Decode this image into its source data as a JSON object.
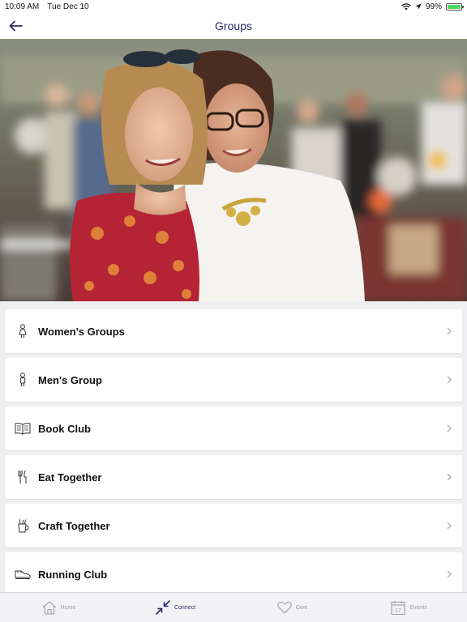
{
  "status_bar": {
    "time": "10:09 AM",
    "date": "Tue Dec 10",
    "battery": "99%"
  },
  "nav": {
    "title": "Groups"
  },
  "hero": {
    "alt_icon": "photo-two-women-smiling"
  },
  "groups": [
    {
      "label": "Women's Groups",
      "icon": "woman-icon"
    },
    {
      "label": "Men's Group",
      "icon": "man-icon"
    },
    {
      "label": "Book Club",
      "icon": "book-icon"
    },
    {
      "label": "Eat Together",
      "icon": "fork-knife-icon"
    },
    {
      "label": "Craft Together",
      "icon": "craft-cup-icon"
    },
    {
      "label": "Running Club",
      "icon": "running-shoe-icon"
    }
  ],
  "tabs": [
    {
      "label": "Home",
      "icon": "home-icon",
      "active": false
    },
    {
      "label": "Connect",
      "icon": "connect-icon",
      "active": true
    },
    {
      "label": "Give",
      "icon": "heart-icon",
      "active": false
    },
    {
      "label": "Events",
      "icon": "calendar-icon",
      "active": false
    }
  ],
  "calendar_day": "17",
  "colors": {
    "accent": "#2a2a6a",
    "background": "#efeff1",
    "battery": "#4cd964"
  }
}
